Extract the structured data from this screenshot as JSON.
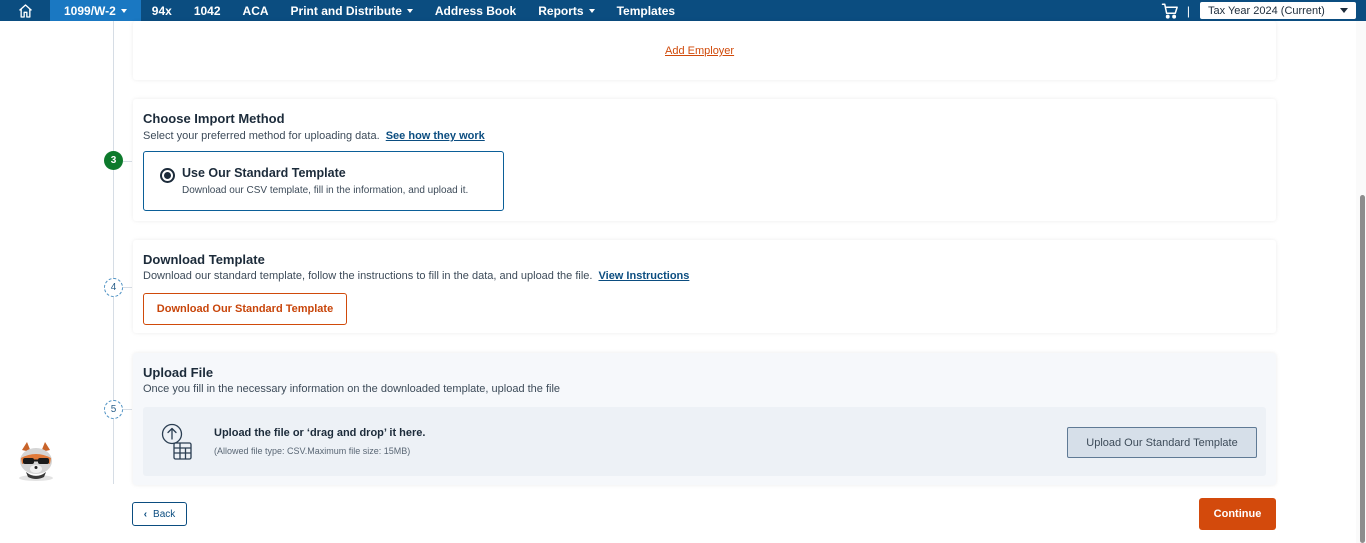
{
  "nav": {
    "items": [
      {
        "label": "1099/W-2",
        "active": true,
        "dropdown": true
      },
      {
        "label": "94x",
        "active": false,
        "dropdown": false
      },
      {
        "label": "1042",
        "active": false,
        "dropdown": false
      },
      {
        "label": "ACA",
        "active": false,
        "dropdown": false
      },
      {
        "label": "Print and Distribute",
        "active": false,
        "dropdown": true
      },
      {
        "label": "Address Book",
        "active": false,
        "dropdown": false
      },
      {
        "label": "Reports",
        "active": false,
        "dropdown": true
      },
      {
        "label": "Templates",
        "active": false,
        "dropdown": false
      }
    ],
    "separator": "|",
    "tax_year": "Tax Year 2024 (Current)",
    "home_icon": "home-icon",
    "cart_icon": "cart-icon"
  },
  "employer_card": {
    "add_employer_link": "Add Employer"
  },
  "steps": {
    "import_method": {
      "number": "3",
      "status": "done",
      "title": "Choose Import Method",
      "subtitle": "Select your preferred method for uploading data.",
      "link": "See how they work",
      "option": {
        "title": "Use Our Standard Template",
        "description": "Download our CSV template, fill in the information, and upload it.",
        "selected": true
      }
    },
    "download": {
      "number": "4",
      "status": "pending",
      "title": "Download Template",
      "subtitle": "Download our standard template, follow the instructions to fill in the data, and upload the file.",
      "link": "View Instructions",
      "button": "Download Our Standard Template"
    },
    "upload": {
      "number": "5",
      "status": "pending",
      "title": "Upload File",
      "subtitle": "Once you fill in the necessary information on the downloaded template, upload the file",
      "drop_main": "Upload the file or ‘drag and drop’ it here.",
      "drop_hint": "(Allowed file type: CSV.Maximum file size: 15MB)",
      "button": "Upload Our Standard Template"
    }
  },
  "footer": {
    "back": "Back",
    "continue": "Continue"
  },
  "colors": {
    "nav_bg": "#0b4d80",
    "nav_active": "#1a78c2",
    "accent_orange": "#d34a0c",
    "step_done": "#0d7a2c"
  }
}
